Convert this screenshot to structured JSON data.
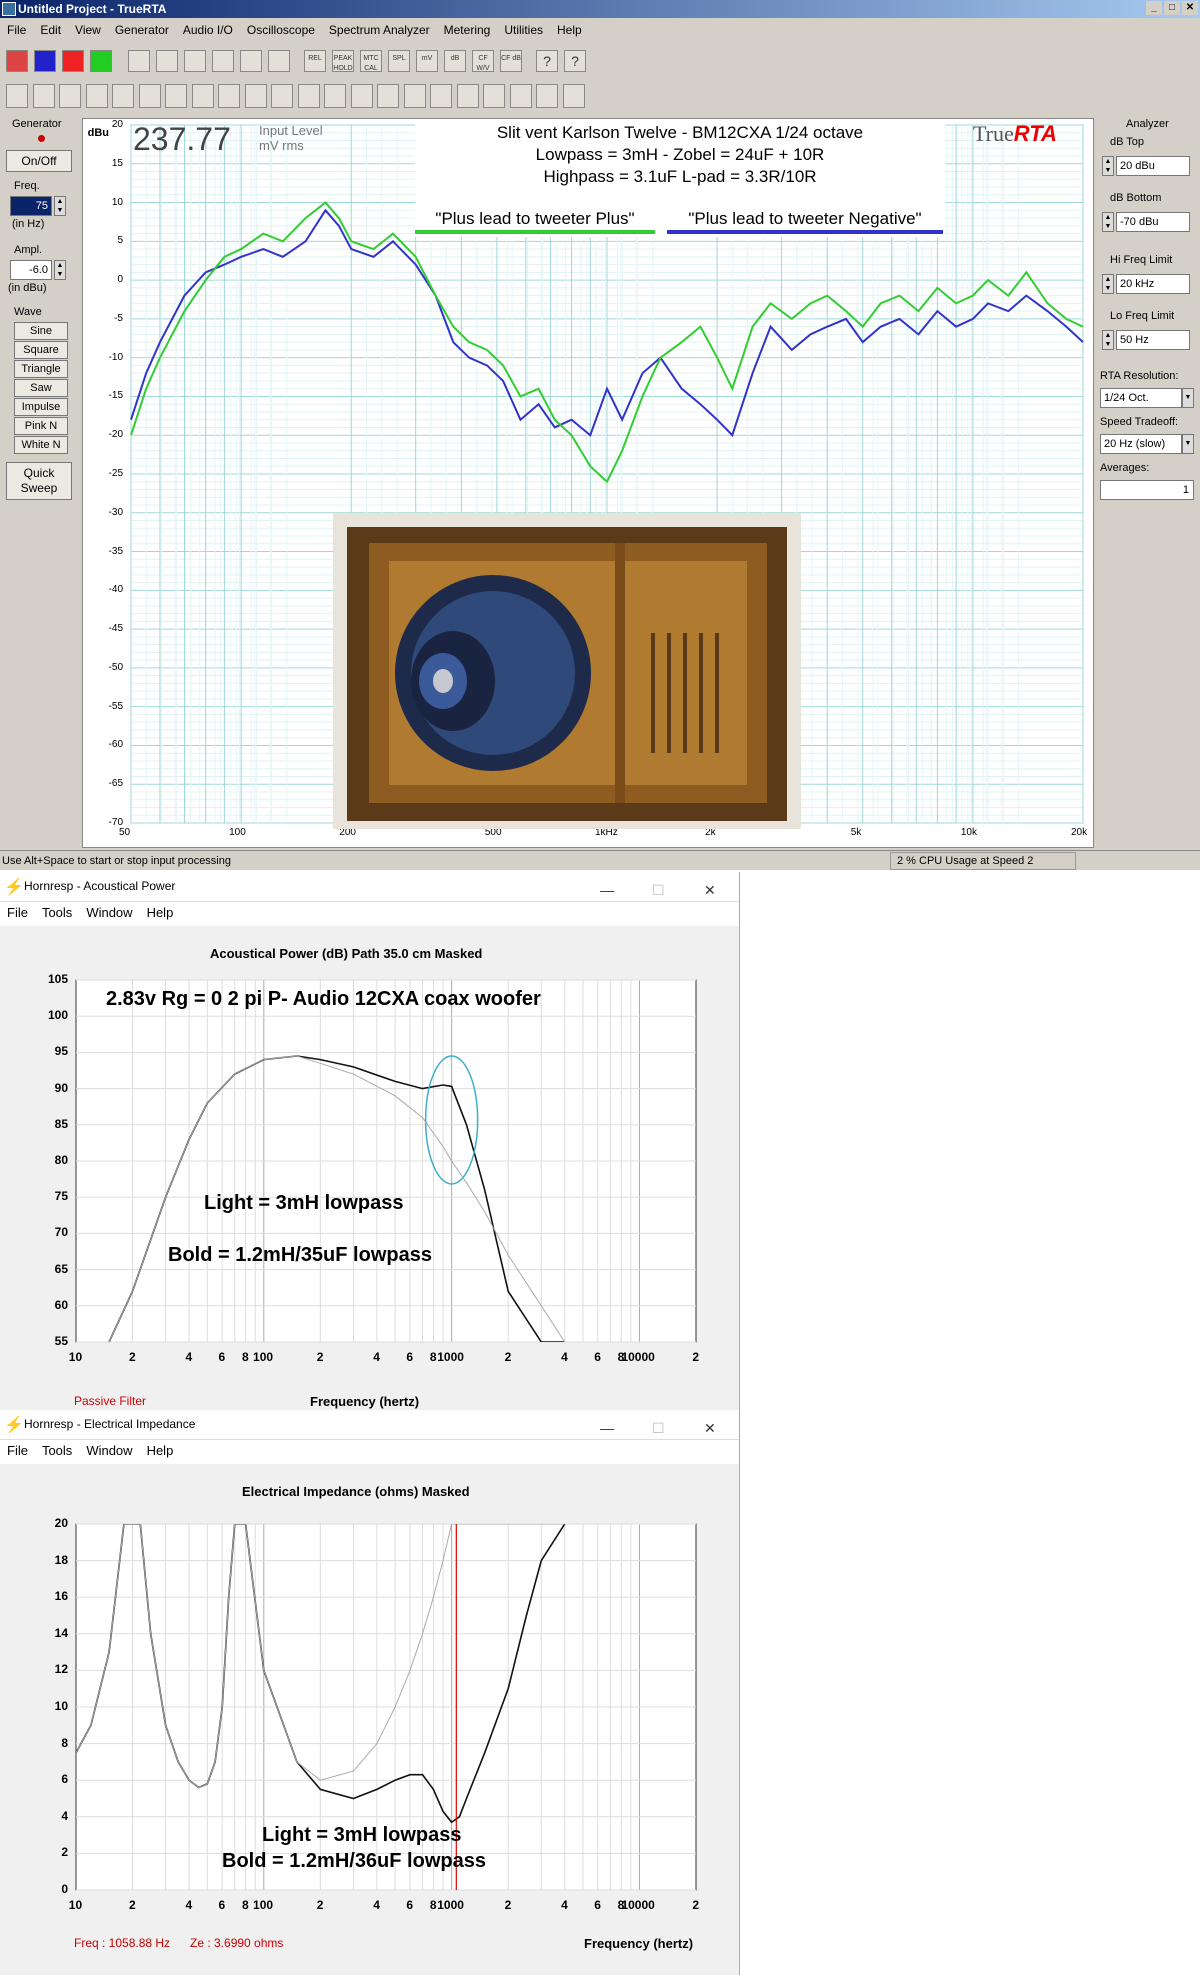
{
  "truerta": {
    "title": "Untitled Project - TrueRTA",
    "menu": [
      "File",
      "Edit",
      "View",
      "Generator",
      "Audio I/O",
      "Oscilloscope",
      "Spectrum Analyzer",
      "Metering",
      "Utilities",
      "Help"
    ],
    "toolbar": [
      "REL",
      "PEAK HOLD",
      "MTC CAL",
      "SPL",
      "mV",
      "dB",
      "CF W/V",
      "CF dB"
    ],
    "left": {
      "generator": "Generator",
      "onoff": "On/Off",
      "freq": "Freq.",
      "freq_val": "75",
      "freq_unit": "(in Hz)",
      "ampl": "Ampl.",
      "ampl_val": "-6.0",
      "ampl_unit": "(in dBu)",
      "wave": "Wave",
      "waves": [
        "Sine",
        "Square",
        "Triangle",
        "Saw",
        "Impulse",
        "Pink N",
        "White N"
      ],
      "quick": "Quick",
      "sweep": "Sweep"
    },
    "right": {
      "analyzer": "Analyzer",
      "db_top": "dB Top",
      "db_top_val": "20 dBu",
      "db_bottom": "dB Bottom",
      "db_bottom_val": "-70 dBu",
      "hi": "Hi Freq Limit",
      "hi_val": "20 kHz",
      "lo": "Lo Freq Limit",
      "lo_val": "50 Hz",
      "res": "RTA Resolution:",
      "res_val": "1/24 Oct.",
      "speed": "Speed Tradeoff:",
      "speed_val": "20 Hz (slow)",
      "avg": "Averages:",
      "avg_val": "1"
    },
    "readout": "237.77",
    "readout_l1": "Input Level",
    "readout_l2": "mV rms",
    "dbu": "dBu",
    "brand_a": "True",
    "brand_b": "RTA",
    "line1": "Slit vent Karlson Twelve - BM12CXA     1/24 octave",
    "line2": "Lowpass = 3mH  - Zobel = 24uF + 10R",
    "line3": "Highpass = 3.1uF   L-pad = 3.3R/10R",
    "legend_green": "\"Plus lead to tweeter Plus\"",
    "legend_blue": "\"Plus lead to tweeter Negative\"",
    "status": "Use Alt+Space to start or stop input processing",
    "cpu": "2 % CPU Usage at Speed 2",
    "colors": {
      "green": "#33cc33",
      "blue": "#3333cc",
      "grid": "#bfe6e6"
    }
  },
  "hornresp1": {
    "title": "Hornresp - Acoustical Power",
    "menu": [
      "File",
      "Tools",
      "Window",
      "Help"
    ],
    "header": "Acoustical Power (dB)    Path 35.0 cm    Masked",
    "headline": "2.83v   Rg = 0   2 pi   P- Audio 12CXA coax woofer",
    "light": "Light = 3mH lowpass",
    "bold": "Bold = 1.2mH/35uF lowpass",
    "footer_left": "Passive Filter",
    "footer_center": "Frequency (hertz)"
  },
  "hornresp2": {
    "title": "Hornresp - Electrical Impedance",
    "menu": [
      "File",
      "Tools",
      "Window",
      "Help"
    ],
    "header": "Electrical Impedance (ohms)    Masked",
    "light": "Light = 3mH lowpass",
    "bold": "Bold = 1.2mH/36uF lowpass",
    "freq_readout": "Freq : 1058.88 Hz",
    "ze_readout": "Ze : 3.6990 ohms",
    "footer_right": "Frequency (hertz)"
  },
  "chart_data": [
    {
      "type": "line",
      "ylabel": "dBu",
      "ylim": [
        -70,
        20
      ],
      "x_scale": "log",
      "xlim": [
        50,
        20000
      ],
      "x_ticks": [
        "50",
        "100",
        "200",
        "500",
        "1kHz",
        "2k",
        "5k",
        "10k",
        "20k"
      ],
      "y_ticks": [
        20,
        15,
        10,
        5,
        0,
        -5,
        -10,
        -15,
        -20,
        -25,
        -30,
        -35,
        -40,
        -45,
        -50,
        -55,
        -60,
        -65,
        -70
      ],
      "x": [
        50,
        55,
        60,
        70,
        80,
        90,
        100,
        115,
        130,
        150,
        170,
        185,
        200,
        230,
        260,
        300,
        340,
        380,
        420,
        470,
        520,
        580,
        650,
        720,
        800,
        900,
        1000,
        1100,
        1250,
        1400,
        1600,
        1800,
        2000,
        2200,
        2500,
        2800,
        3200,
        3600,
        4000,
        4500,
        5000,
        5600,
        6300,
        7100,
        8000,
        9000,
        10000,
        11000,
        12500,
        14000,
        16000,
        18000,
        20000
      ],
      "series": [
        {
          "values": [
            -18,
            -12,
            -8,
            -2,
            1,
            2,
            3,
            4,
            3,
            5,
            9,
            7,
            4,
            3,
            5,
            2,
            -2,
            -8,
            -10,
            -11,
            -13,
            -18,
            -16,
            -19,
            -18,
            -20,
            -14,
            -18,
            -12,
            -10,
            -14,
            -16,
            -18,
            -20,
            -12,
            -6,
            -9,
            -7,
            -6,
            -5,
            -8,
            -6,
            -5,
            -7,
            -4,
            -6,
            -5,
            -3,
            -4,
            -2,
            -4,
            -6,
            -8
          ],
          "color": "#3333cc"
        },
        {
          "values": [
            -20,
            -14,
            -10,
            -4,
            0,
            3,
            4,
            6,
            5,
            8,
            10,
            8,
            5,
            4,
            6,
            3,
            -2,
            -6,
            -8,
            -9,
            -11,
            -15,
            -14,
            -18,
            -20,
            -24,
            -26,
            -22,
            -15,
            -10,
            -8,
            -6,
            -10,
            -14,
            -6,
            -3,
            -5,
            -3,
            -2,
            -4,
            -6,
            -3,
            -2,
            -4,
            -1,
            -3,
            -2,
            0,
            -2,
            1,
            -3,
            -5,
            -6
          ],
          "color": "#33cc33"
        }
      ]
    },
    {
      "type": "line",
      "headline": "2.83v   Rg = 0   2 pi   P- Audio 12CXA coax woofer",
      "xlabel": "Frequency (hertz)",
      "x_scale": "log",
      "xlim": [
        10,
        20000
      ],
      "ylim": [
        55,
        105
      ],
      "x_ticks": [
        "10",
        "2",
        "4",
        "6",
        "8",
        "100",
        "2",
        "4",
        "6",
        "8",
        "1000",
        "2",
        "4",
        "6",
        "8",
        "10000",
        "2"
      ],
      "y_ticks": [
        105,
        100,
        95,
        90,
        85,
        80,
        75,
        70,
        65,
        60,
        55
      ],
      "x": [
        15,
        20,
        30,
        40,
        50,
        70,
        100,
        150,
        200,
        300,
        500,
        700,
        900,
        1000,
        1200,
        1500,
        2000,
        3000,
        4000
      ],
      "series": [
        {
          "values": [
            55,
            62,
            75,
            83,
            88,
            92,
            94,
            94.5,
            94,
            93,
            91,
            90,
            90.5,
            90.3,
            85,
            76,
            62,
            55,
            55
          ]
        },
        {
          "values": [
            55,
            62,
            75,
            83,
            88,
            92,
            94,
            94.5,
            93.5,
            92,
            89,
            86,
            82,
            80,
            77,
            73,
            67,
            60,
            55
          ]
        }
      ]
    },
    {
      "type": "line",
      "header": "Electrical Impedance (ohms)    Masked",
      "xlabel": "Frequency (hertz)",
      "x_scale": "log",
      "xlim": [
        10,
        20000
      ],
      "ylim": [
        0,
        20
      ],
      "x_ticks": [
        "10",
        "2",
        "4",
        "6",
        "8",
        "100",
        "2",
        "4",
        "6",
        "8",
        "1000",
        "2",
        "4",
        "6",
        "8",
        "10000",
        "2"
      ],
      "y_ticks": [
        20,
        18,
        16,
        14,
        12,
        10,
        8,
        6,
        4,
        2,
        0
      ],
      "x": [
        10,
        12,
        15,
        18,
        20,
        22,
        25,
        30,
        35,
        40,
        45,
        50,
        55,
        60,
        65,
        70,
        80,
        100,
        150,
        200,
        300,
        400,
        500,
        600,
        700,
        800,
        900,
        1000,
        1100,
        1200,
        1500,
        2000,
        2500,
        3000,
        4000
      ],
      "series": [
        {
          "values": [
            7.5,
            9,
            13,
            20,
            20,
            20,
            14,
            9,
            7,
            6,
            5.6,
            5.8,
            7,
            10,
            16,
            20,
            20,
            12,
            7,
            5.5,
            5,
            5.5,
            6,
            6.3,
            6.3,
            5.5,
            4.3,
            3.7,
            4,
            5,
            7.5,
            11,
            15,
            18,
            20
          ]
        },
        {
          "values": [
            7.5,
            9,
            13,
            20,
            20,
            20,
            14,
            9,
            7,
            6,
            5.6,
            5.8,
            7,
            10,
            16,
            20,
            20,
            12,
            7,
            6,
            6.5,
            8,
            10,
            12,
            14,
            16,
            18,
            20,
            20,
            20,
            20,
            20,
            20,
            20,
            20
          ]
        }
      ],
      "cursor_x": 1058.88
    }
  ]
}
